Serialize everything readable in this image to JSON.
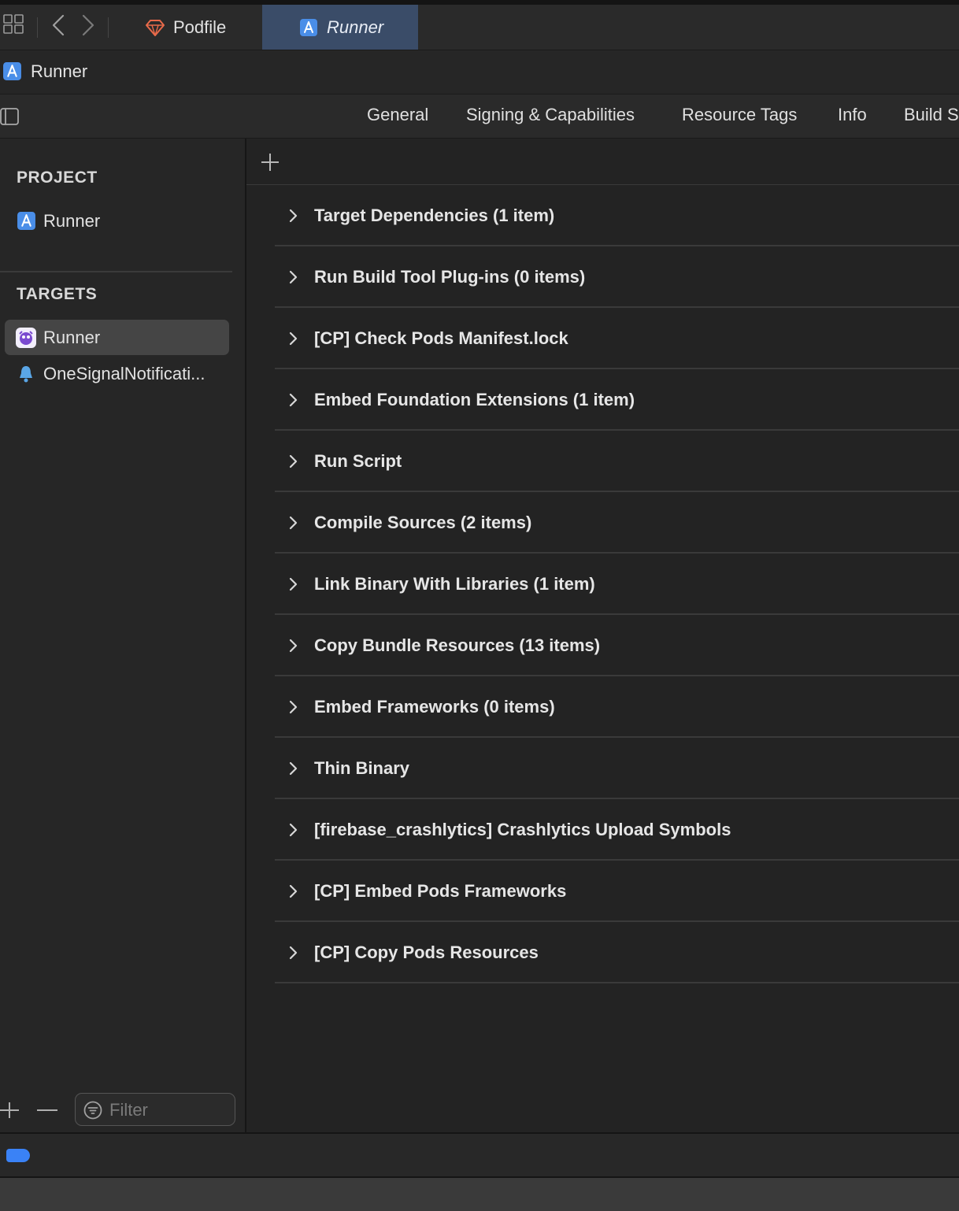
{
  "window_tabs": [
    {
      "label": "Podfile",
      "icon": "ruby-gem-icon",
      "active": false
    },
    {
      "label": "Runner",
      "icon": "xcode-project-icon",
      "active": true
    }
  ],
  "breadcrumb": {
    "label": "Runner",
    "icon": "xcode-project-icon"
  },
  "editor_tabs": [
    "General",
    "Signing & Capabilities",
    "Resource Tags",
    "Info",
    "Build S"
  ],
  "sidebar": {
    "project_title": "PROJECT",
    "project_item": "Runner",
    "targets_title": "TARGETS",
    "targets": [
      {
        "label": "Runner",
        "icon": "app-icon",
        "selected": true
      },
      {
        "label": "OneSignalNotificati...",
        "icon": "bell-icon",
        "selected": false
      }
    ],
    "filter_placeholder": "Filter"
  },
  "build_phases": [
    "Target Dependencies (1 item)",
    "Run Build Tool Plug-ins (0 items)",
    "[CP] Check Pods Manifest.lock",
    "Embed Foundation Extensions (1 item)",
    "Run Script",
    "Compile Sources (2 items)",
    "Link Binary With Libraries (1 item)",
    "Copy Bundle Resources (13 items)",
    "Embed Frameworks (0 items)",
    "Thin Binary",
    "[firebase_crashlytics] Crashlytics Upload Symbols",
    "[CP] Embed Pods Frameworks",
    "[CP] Copy Pods Resources"
  ],
  "colors": {
    "accent": "#3a82f6",
    "selected_tab": "#3a4c68",
    "background": "#252525"
  }
}
